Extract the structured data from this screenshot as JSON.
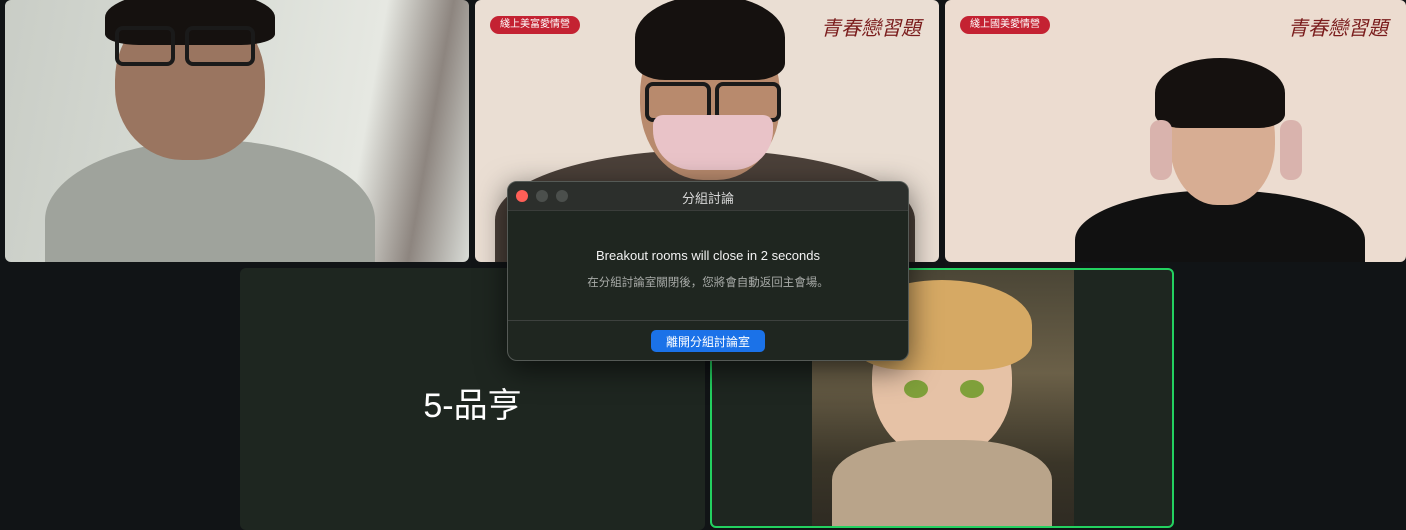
{
  "tiles": [
    {
      "id": "p1"
    },
    {
      "id": "p2",
      "badge": "綫上美富愛情營",
      "logo": "青春戀習題"
    },
    {
      "id": "p3",
      "badge": "綫上國美愛情營",
      "logo": "青春戀習題"
    },
    {
      "id": "p4",
      "room_name": "5-品亨"
    },
    {
      "id": "p5",
      "active_speaker": true,
      "highlight_color": "#23d160"
    }
  ],
  "dialog": {
    "title": "分組討論",
    "message": "Breakout rooms will close in 2 seconds",
    "submessage": "在分組討論室關閉後，您將會自動返回主會場。",
    "leave_button": "離開分組討論室"
  },
  "colors": {
    "background": "#111416",
    "tile_bg": "#1e2620",
    "button_blue": "#1b72e8",
    "badge_red": "#c42232"
  }
}
